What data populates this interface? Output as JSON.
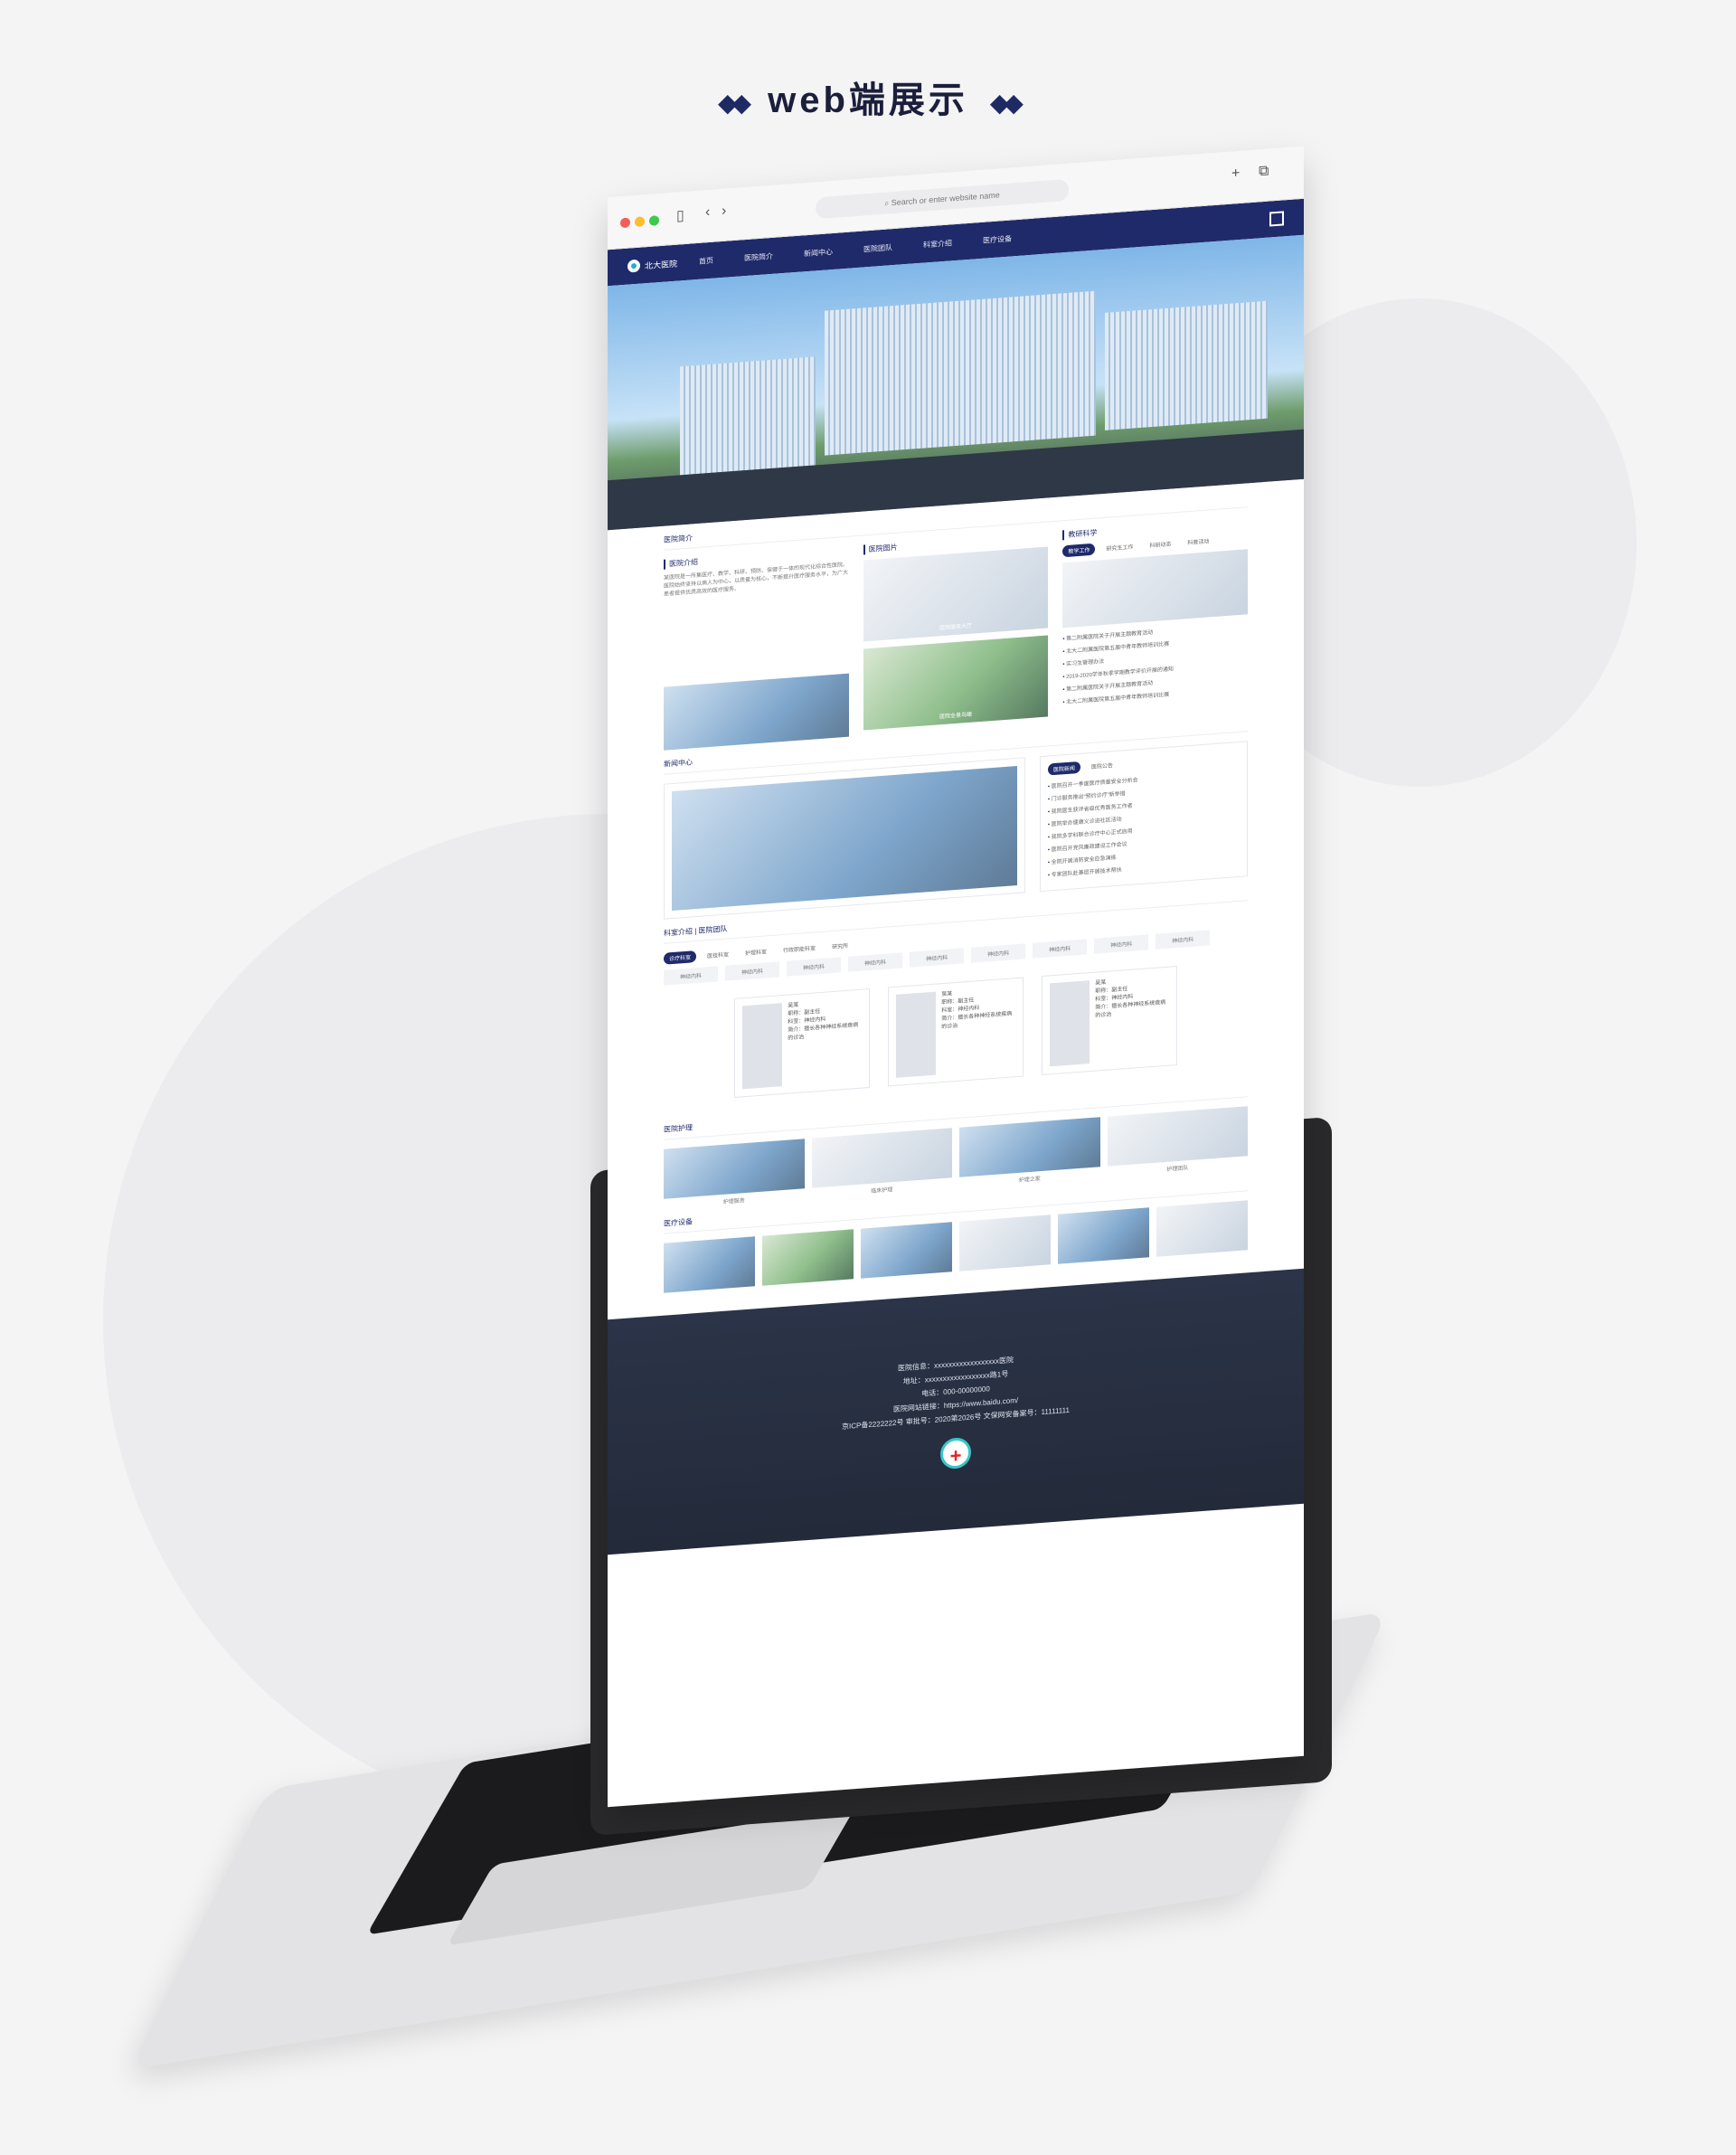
{
  "heading": {
    "title": "web端展示"
  },
  "browser": {
    "url_placeholder": "Search or enter website name"
  },
  "nav": {
    "logo": "北大医院",
    "items": [
      "首页",
      "医院简介",
      "新闻中心",
      "医院团队",
      "科室介绍",
      "医疗设备"
    ]
  },
  "intro": {
    "section_title": "医院简介",
    "card1_title": "医院介绍",
    "card1_text": "某医院是一所集医疗、教学、科研、预防、保健于一体的现代化综合性医院。医院始终坚持以病人为中心，以质量为核心，不断提升医疗服务水平，为广大患者提供优质高效的医疗服务。",
    "card2_title": "医院图片",
    "card2_captions": [
      "医院服务大厅",
      "医院全景鸟瞰"
    ],
    "card3_title": "教研科学",
    "card3_tabs": [
      "教学工作",
      "研究生工作",
      "科研动态",
      "科普活动"
    ],
    "card3_items": [
      "第二附属医院关于开展主题教育活动",
      "北大二附属医院第五届中青年教师培训比赛",
      "实习生管理办法",
      "2019-2020学年秋季学期教学评价开展的通知",
      "第二附属医院关于开展主题教育活动",
      "北大二附属医院第五届中青年教师培训比赛"
    ]
  },
  "news": {
    "section_title": "新闻中心",
    "tabs": [
      "医院新闻",
      "医院公告"
    ],
    "items": [
      "医院召开一季度医疗质量安全分析会",
      "门诊服务推出“预约诊疗”新举措",
      "我院医生获评省级优秀医务工作者",
      "医院举办健康义诊进社区活动",
      "我院多学科联合诊疗中心正式启用",
      "医院召开党风廉政建设工作会议",
      "全院开展消防安全应急演练",
      "专家团队赴基层开展技术帮扶"
    ]
  },
  "departments": {
    "section_title": "科室介绍 | 医院团队",
    "tabs": [
      "诊疗科室",
      "医技科室",
      "护理科室",
      "行政职能科室",
      "研究所"
    ],
    "tags": [
      "神经内科",
      "神经内科",
      "神经内科",
      "神经内科",
      "神经内科",
      "神经内科",
      "神经内科",
      "神经内科",
      "神经内科"
    ],
    "doctors": [
      {
        "name": "吴某",
        "title": "职称：副主任",
        "dept": "科室：神经内科",
        "desc": "简介：擅长各种神经系统疾病的诊治"
      },
      {
        "name": "吴某",
        "title": "职称：副主任",
        "dept": "科室：神经内科",
        "desc": "简介：擅长各种神经系统疾病的诊治"
      },
      {
        "name": "吴某",
        "title": "职称：副主任",
        "dept": "科室：神经内科",
        "desc": "简介：擅长各种神经系统疾病的诊治"
      }
    ]
  },
  "nursing": {
    "section_title": "医院护理",
    "items": [
      "护理服务",
      "临床护理",
      "护理之家",
      "护理团队"
    ]
  },
  "equipment": {
    "section_title": "医疗设备"
  },
  "footer": {
    "lines": [
      "医院信息：xxxxxxxxxxxxxxxxxx医院",
      "地址：xxxxxxxxxxxxxxxxxx路1号",
      "电话：000-00000000",
      "医院网站链接：https://www.baidu.com/",
      "京ICP备2222222号    审批号：2020第2026号    文保网安备案号：11111111"
    ]
  }
}
